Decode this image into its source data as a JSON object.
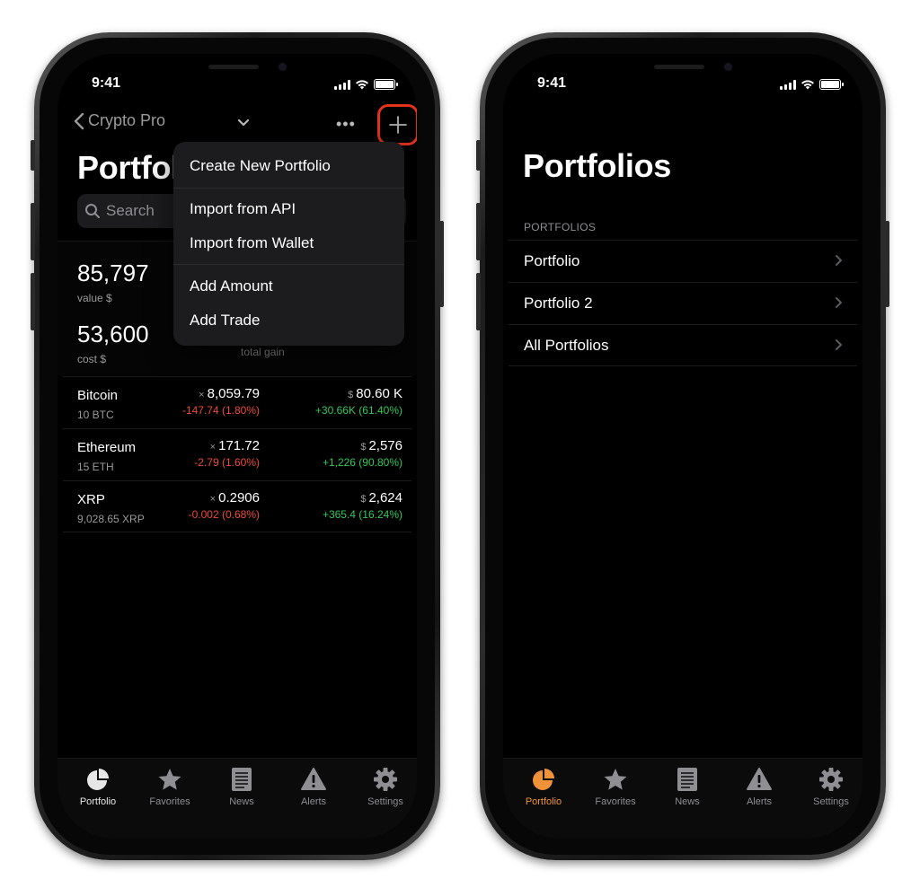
{
  "status": {
    "time": "9:41"
  },
  "left": {
    "nav": {
      "back_label": "Crypto Pro",
      "more_label": "•••"
    },
    "title": "Portfolio",
    "search": {
      "placeholder": "Search"
    },
    "summary": {
      "value": "85,797",
      "value_label": "value $",
      "cost": "53,600",
      "cost_label": "cost $",
      "gain_label": "total gain"
    },
    "menu": {
      "items": [
        "Create New Portfolio",
        "Import from API",
        "Import from Wallet",
        "Add Amount",
        "Add Trade"
      ]
    },
    "coins": [
      {
        "name": "Bitcoin",
        "qty": "10 BTC",
        "price_sym": "×",
        "price": "8,059.79",
        "change": "-147.74 (1.80%)",
        "val_sym": "$",
        "value": "80.60 K",
        "gain": "+30.66K (61.40%)"
      },
      {
        "name": "Ethereum",
        "qty": "15 ETH",
        "price_sym": "×",
        "price": "171.72",
        "change": "-2.79 (1.60%)",
        "val_sym": "$",
        "value": "2,576",
        "gain": "+1,226 (90.80%)"
      },
      {
        "name": "XRP",
        "qty": "9,028.65 XRP",
        "price_sym": "×",
        "price": "0.2906",
        "change": "-0.002 (0.68%)",
        "val_sym": "$",
        "value": "2,624",
        "gain": "+365.4 (16.24%)"
      }
    ]
  },
  "right": {
    "title": "Portfolios",
    "section_header": "PORTFOLIOS",
    "rows": [
      "Portfolio",
      "Portfolio 2",
      "All Portfolios"
    ]
  },
  "tabs": [
    {
      "label": "Portfolio",
      "icon": "pie-chart-icon"
    },
    {
      "label": "Favorites",
      "icon": "star-icon"
    },
    {
      "label": "News",
      "icon": "newspaper-icon"
    },
    {
      "label": "Alerts",
      "icon": "warning-icon"
    },
    {
      "label": "Settings",
      "icon": "gear-icon"
    }
  ],
  "colors": {
    "background": "#000000",
    "negative": "#ef4a3c",
    "positive": "#34c759",
    "active_tab_orange": "#f0923a",
    "highlight_ring": "#e2321c"
  }
}
